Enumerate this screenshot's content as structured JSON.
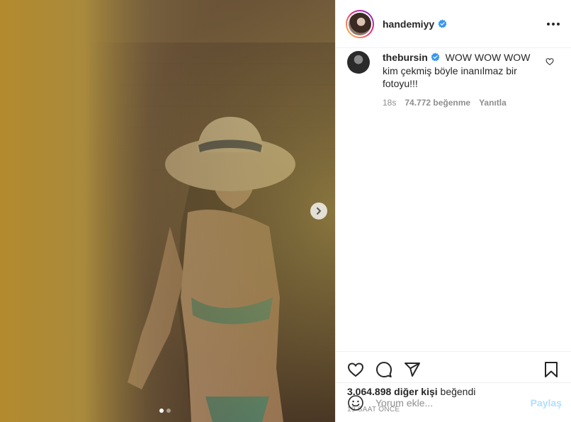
{
  "post": {
    "author": {
      "username": "handemiyy",
      "verified": true
    },
    "media": {
      "carousel_count": 2,
      "current_index": 0,
      "next_icon": "chevron-right-icon"
    },
    "comments": [
      {
        "username": "thebursin",
        "verified": true,
        "text": "WOW WOW WOW kim çekmiş böyle inanılmaz bir fotoyu!!!",
        "time_ago": "18s",
        "likes_label": "74.772 beğenme",
        "reply_label": "Yanıtla"
      }
    ],
    "actions": {
      "like_icon": "heart-icon",
      "comment_icon": "comment-bubble-icon",
      "share_icon": "paper-plane-icon",
      "save_icon": "bookmark-icon"
    },
    "likes": {
      "count": "3.064.898 diğer kişi",
      "suffix": " beğendi"
    },
    "timestamp": "19 SAAT ÖNCE",
    "add_comment": {
      "placeholder": "Yorum ekle...",
      "post_label": "Paylaş",
      "emoji_icon": "smiley-icon"
    }
  },
  "colors": {
    "verified": "#3897f0",
    "muted": "#8e8e8e",
    "post_button_disabled": "#b2dffc",
    "text": "#262626"
  }
}
